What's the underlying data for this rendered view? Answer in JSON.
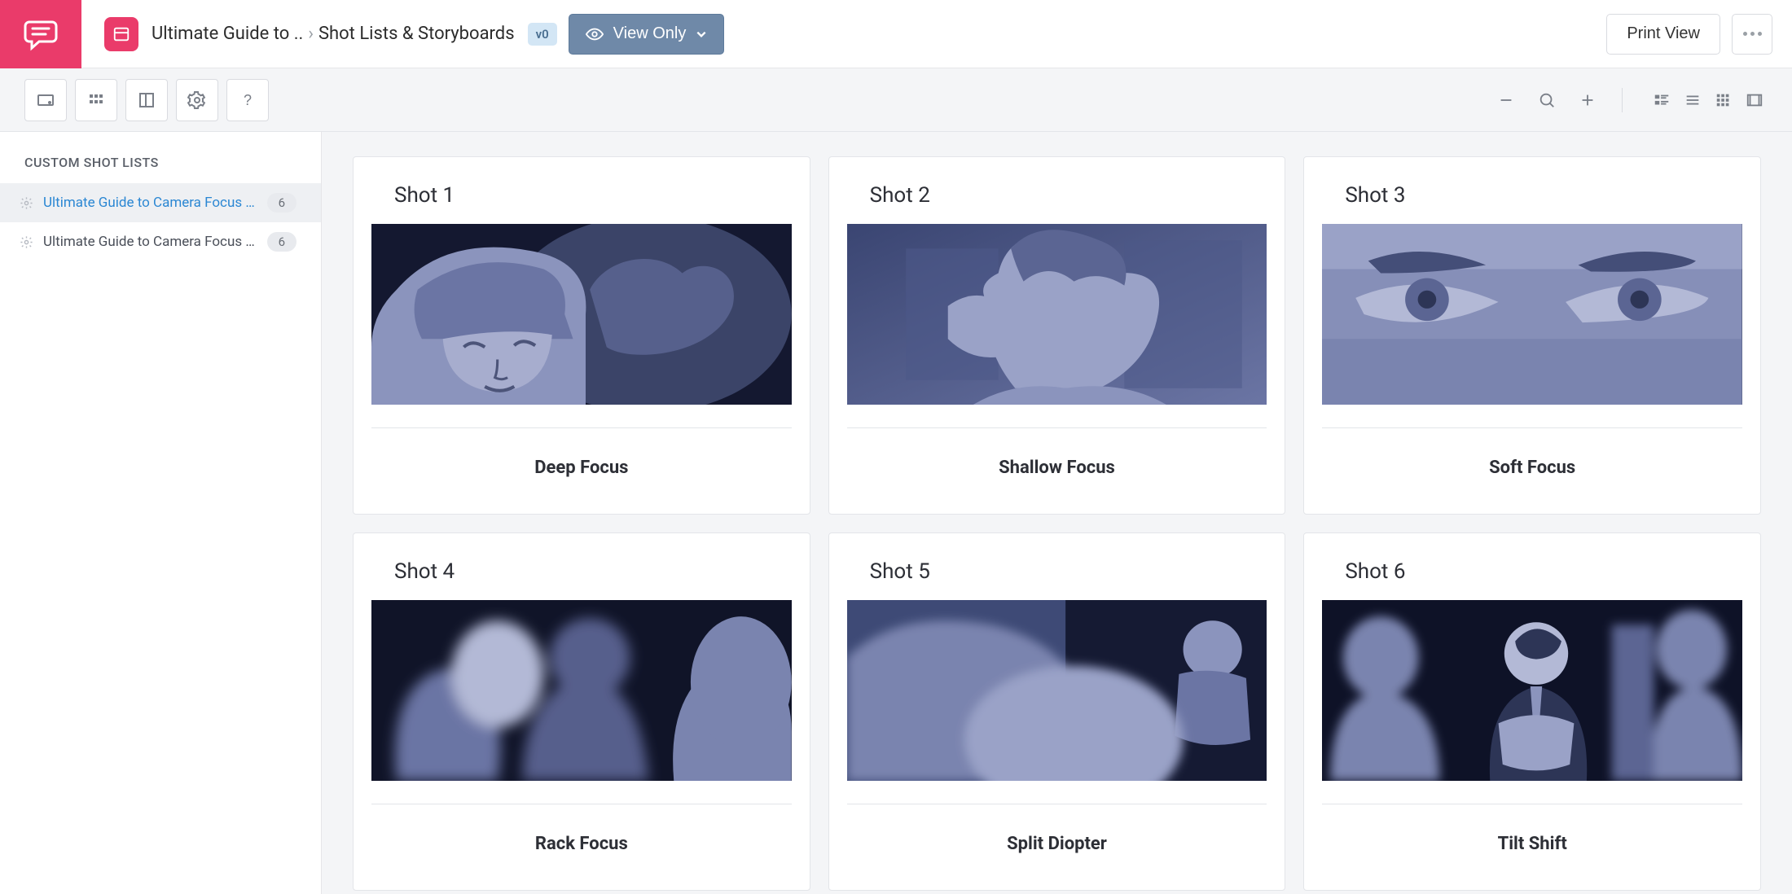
{
  "header": {
    "breadcrumb_project": "Ultimate Guide to ..",
    "breadcrumb_page": "Shot Lists & Storyboards",
    "version": "v0",
    "view_only_label": "View Only",
    "print_label": "Print View"
  },
  "sidebar": {
    "heading": "CUSTOM SHOT LISTS",
    "items": [
      {
        "label": "Ultimate Guide to Camera Focus i...",
        "count": "6",
        "active": true
      },
      {
        "label": "Ultimate Guide to Camera Focus in...",
        "count": "6",
        "active": false
      }
    ]
  },
  "shots": [
    {
      "title": "Shot 1",
      "caption": "Deep Focus"
    },
    {
      "title": "Shot 2",
      "caption": "Shallow Focus"
    },
    {
      "title": "Shot 3",
      "caption": "Soft Focus"
    },
    {
      "title": "Shot 4",
      "caption": "Rack Focus"
    },
    {
      "title": "Shot 5",
      "caption": "Split Diopter"
    },
    {
      "title": "Shot 6",
      "caption": "Tilt Shift"
    }
  ],
  "colors": {
    "accent_pink": "#ea3b6a",
    "btn_blue_gray": "#6f89a8",
    "link_blue": "#2b87d3",
    "storyboard_navy": "#141830",
    "storyboard_mid": "#6b75a4",
    "storyboard_light": "#9aa2c7"
  }
}
